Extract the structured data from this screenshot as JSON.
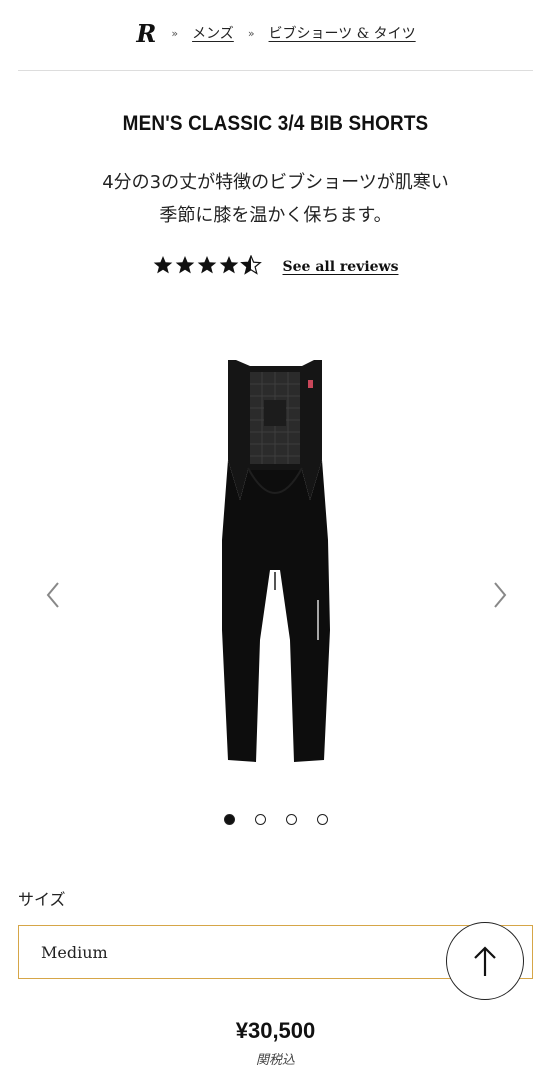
{
  "breadcrumb": {
    "logo": "R",
    "separator": "»",
    "items": [
      "メンズ",
      "ビブショーツ & タイツ"
    ]
  },
  "product": {
    "title": "MEN'S CLASSIC 3/4 BIB SHORTS",
    "description_line1": "4分の3の丈が特徴のビブショーツが肌寒い",
    "description_line2": "季節に膝を温かく保ちます。",
    "rating": 4.5,
    "stars_icon": "star-rating-icon",
    "reviews_link": "See all reviews",
    "image_icon": "bib-tights-product-image"
  },
  "gallery": {
    "slide_count": 4,
    "active_slide": 1,
    "prev_icon": "chevron-left-icon",
    "next_icon": "chevron-right-icon"
  },
  "size": {
    "label": "サイズ",
    "selected": "Medium"
  },
  "scroll_top_icon": "arrow-up-icon",
  "price": {
    "amount": "¥30,500",
    "tax_note": "関税込"
  },
  "colors": {
    "select_border": "#d6a648",
    "text": "#111111",
    "divider": "#dddddd"
  }
}
